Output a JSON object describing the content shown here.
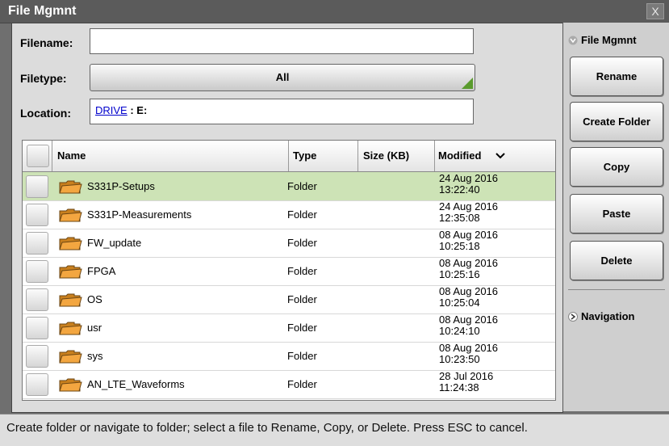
{
  "window": {
    "title": "File Mgmnt",
    "close_label": "X"
  },
  "form": {
    "filename_label": "Filename:",
    "filename_value": "",
    "filetype_label": "Filetype:",
    "filetype_value": "All",
    "location_label": "Location:",
    "location_link": "DRIVE",
    "location_sep": " : ",
    "location_drive": "E:"
  },
  "table": {
    "headers": {
      "name": "Name",
      "type": "Type",
      "size": "Size (KB)",
      "modified": "Modified"
    },
    "rows": [
      {
        "name": "S331P-Setups",
        "type": "Folder",
        "date": "24 Aug 2016",
        "time": "13:22:40"
      },
      {
        "name": "S331P-Measurements",
        "type": "Folder",
        "date": "24 Aug 2016",
        "time": "12:35:08"
      },
      {
        "name": "FW_update",
        "type": "Folder",
        "date": "08 Aug 2016",
        "time": "10:25:18"
      },
      {
        "name": "FPGA",
        "type": "Folder",
        "date": "08 Aug 2016",
        "time": "10:25:16"
      },
      {
        "name": "OS",
        "type": "Folder",
        "date": "08 Aug 2016",
        "time": "10:25:04"
      },
      {
        "name": "usr",
        "type": "Folder",
        "date": "08 Aug 2016",
        "time": "10:24:10"
      },
      {
        "name": "sys",
        "type": "Folder",
        "date": "08 Aug 2016",
        "time": "10:23:50"
      },
      {
        "name": "AN_LTE_Waveforms",
        "type": "Folder",
        "date": "28 Jul 2016",
        "time": "11:24:38"
      }
    ]
  },
  "sidebar": {
    "section_title": "File Mgmnt",
    "buttons": [
      "Rename",
      "Create Folder",
      "Copy",
      "Paste",
      "Delete"
    ],
    "navigation_label": "Navigation"
  },
  "status": {
    "text": "Create folder or navigate to folder; select a file to Rename, Copy, or Delete. Press ESC to cancel."
  },
  "colors": {
    "selected_row": "#cde3b6",
    "accent_green": "#5a9b2d",
    "link_blue": "#0000cc",
    "folder_orange": "#f3a640"
  }
}
